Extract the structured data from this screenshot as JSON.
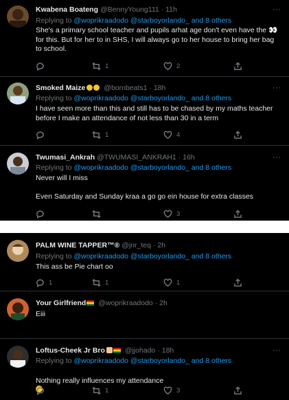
{
  "colors": {
    "background": "#000000",
    "text": "#e7e9ea",
    "muted": "#71767b",
    "link": "#1d9bf0",
    "divider": "#2f3336",
    "separator": "#ffffff"
  },
  "tweets_top": [
    {
      "name": "Kwabena Boateng",
      "handle": "@BennyYoung111",
      "time": "· 11h",
      "reply_prefix": "Replying to ",
      "mentions": "@woprikraadodo @starboyorlando_",
      "reply_suffix": " and 8 others",
      "text": "She's a primary school teacher and pupils arhat age don't even have the 👀 for this. But for her to in SHS, I will always go to her house to bring her bag to school.",
      "replies": "",
      "retweets": "1",
      "likes": "2"
    },
    {
      "name": "Smoked Maize",
      "handle": "@bornbeats1",
      "time": "· 18h",
      "reply_prefix": "Replying to ",
      "mentions": "@woprikraadodo @starboyorlando_",
      "reply_suffix": " and 8 others",
      "text": "I have seen more than this and still has to be chased by my maths teacher before I make an attendance of not less than 30 in a term",
      "replies": "",
      "retweets": "1",
      "likes": "4"
    },
    {
      "name": "Twumasi_Ankrah",
      "handle": "@TWUMASI_ANKRAH1",
      "time": "· 16h",
      "reply_prefix": "Replying to ",
      "mentions": "@woprikraadodo @starboyorlando_",
      "reply_suffix": " and 8 others",
      "text": "Never will I miss\n\nEven Saturday and Sunday kraa a go go ein house for extra classes",
      "replies": "",
      "retweets": "",
      "likes": "3"
    }
  ],
  "tweets_bottom": [
    {
      "name": "PALM WINE TAPPER™®",
      "handle": "@jnr_teq",
      "time": "· 2h",
      "reply_prefix": "Replying to ",
      "mentions": "@woprikraadodo @starboyorlando_",
      "reply_suffix": " and 8 others",
      "text": "This ass be Pie chart oo",
      "replies": "1",
      "retweets": "1",
      "likes": "1",
      "share": ""
    },
    {
      "name": "Your Girlfriend",
      "handle": "@woprikraadodo",
      "time": "· 2h",
      "text": "Eiii"
    },
    {
      "name": "Loftus-Cheek Jr Bro",
      "handle": "@jjohado",
      "time": "· 18h",
      "reply_prefix": "Replying to ",
      "mentions": "@woprikraadodo @starboyorlando_",
      "reply_suffix": " and 8 others",
      "text": "Nothing really influences my attendance",
      "replies": "",
      "retweets": "1",
      "likes": "3"
    }
  ],
  "icons": {
    "reply": "reply-icon",
    "retweet": "retweet-icon",
    "like": "heart-icon",
    "share": "share-icon",
    "more": "more-icon"
  }
}
